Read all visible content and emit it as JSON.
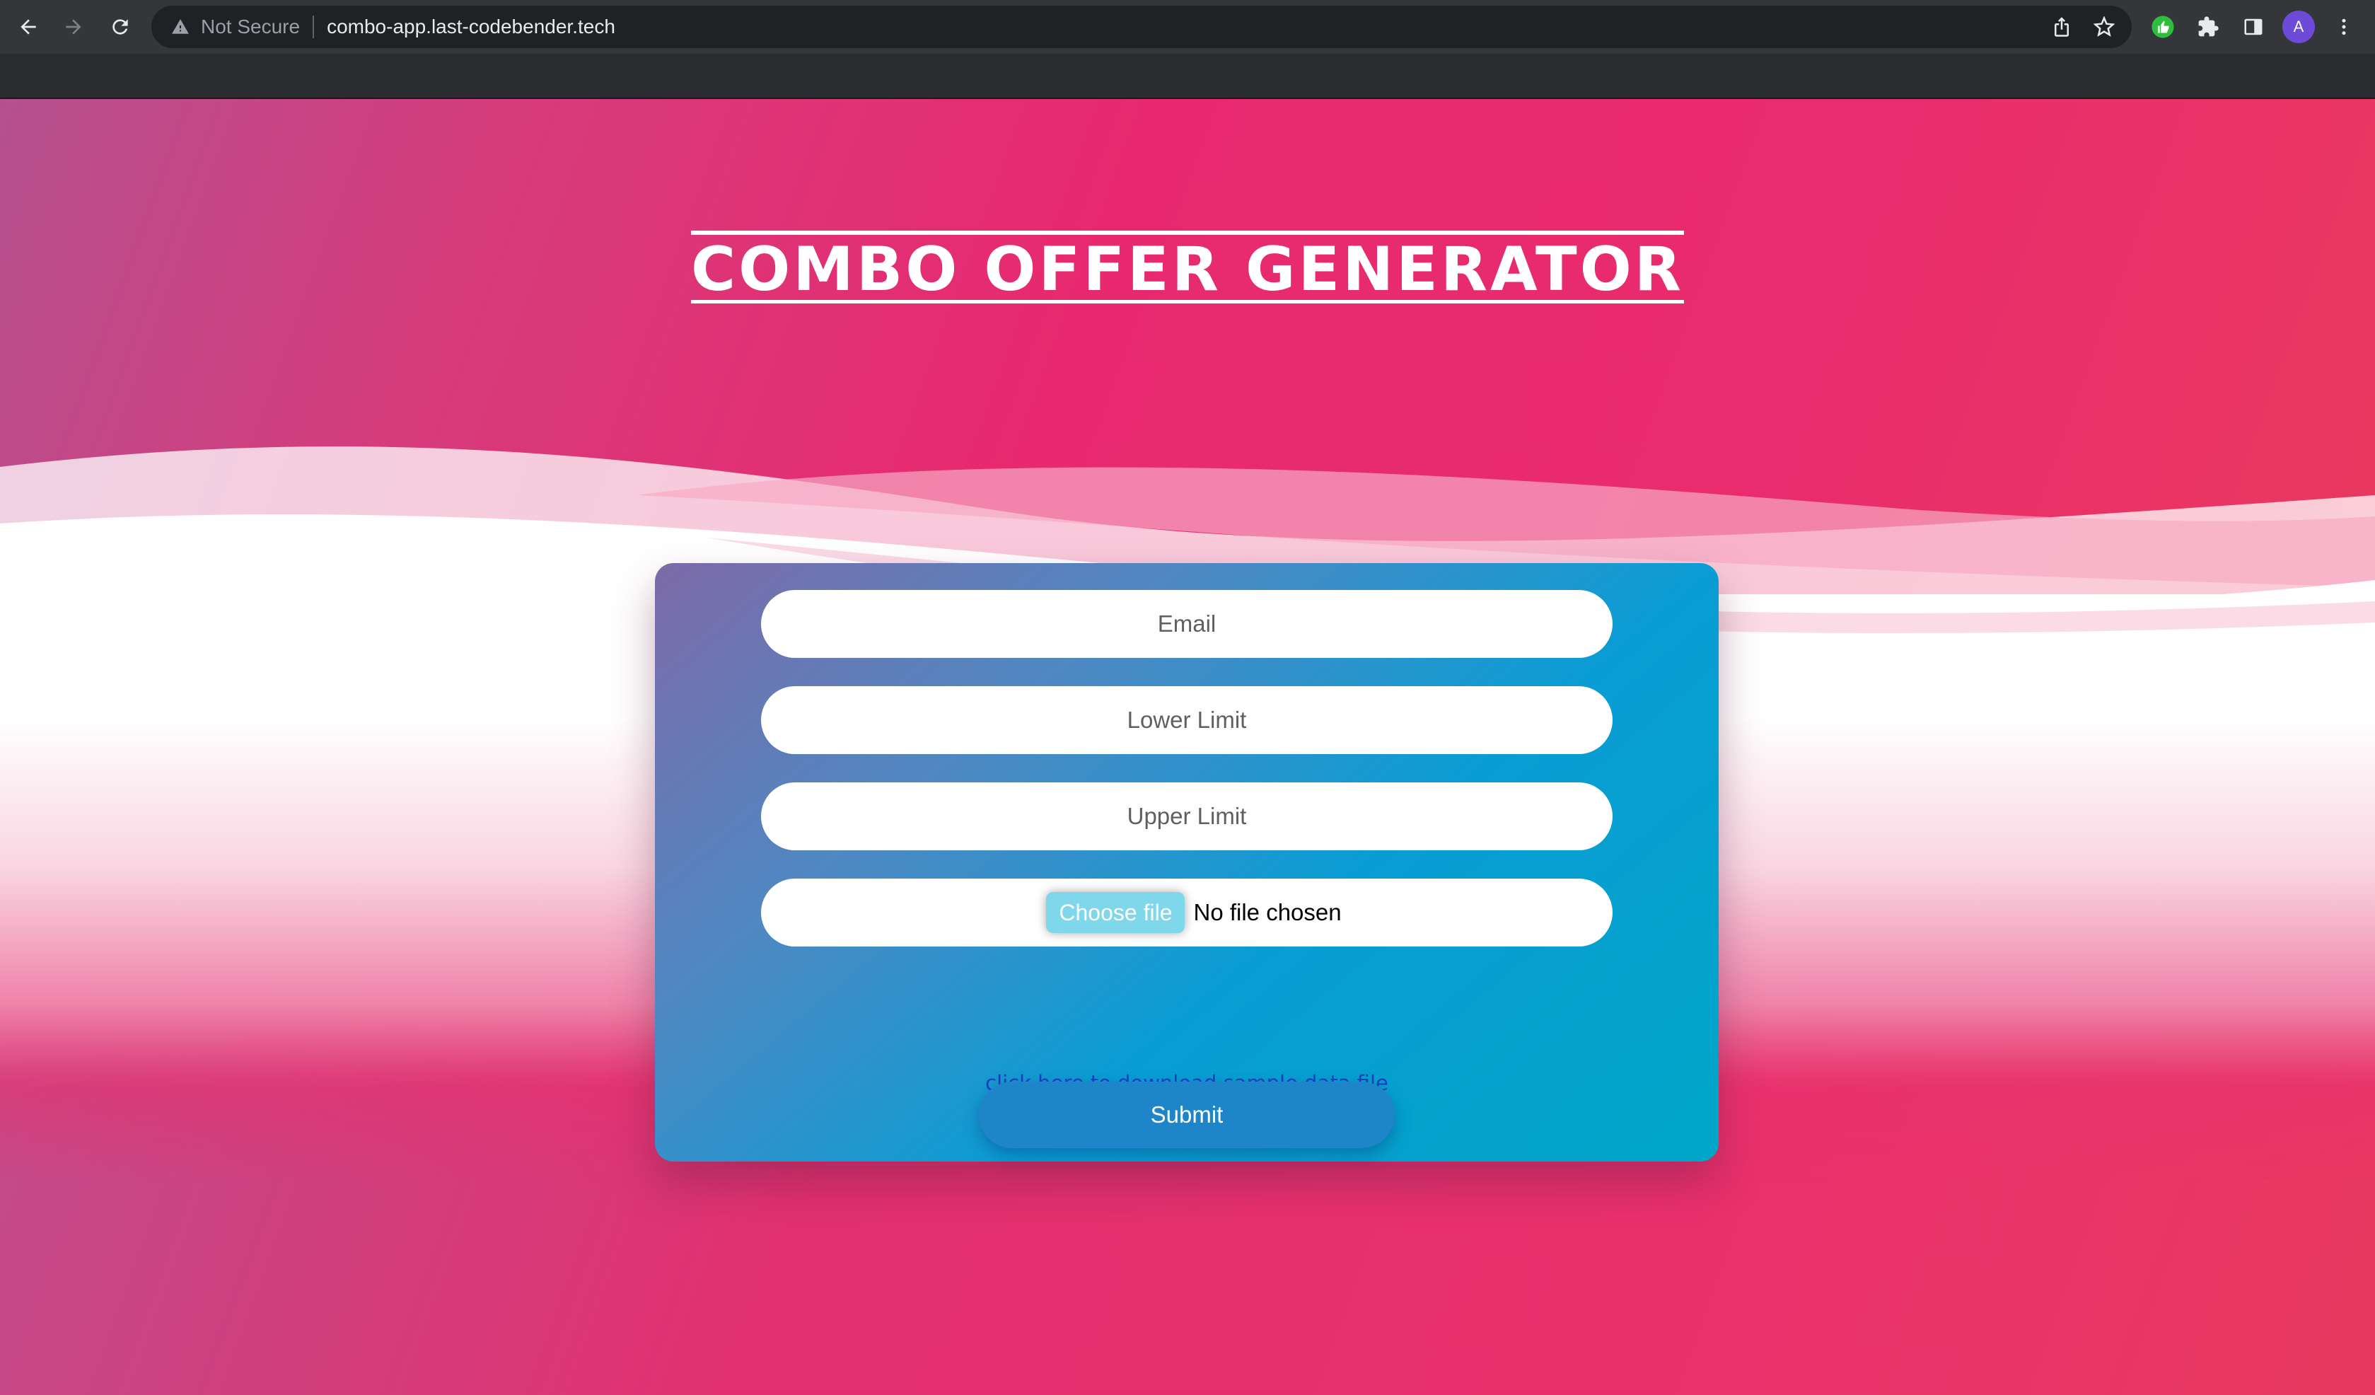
{
  "browser": {
    "security_label": "Not Secure",
    "url": "combo-app.last-codebender.tech",
    "profile_initial": "A"
  },
  "page": {
    "title": "COMBO OFFER GENERATOR"
  },
  "form": {
    "email_placeholder": "Email",
    "lower_limit_placeholder": "Lower Limit",
    "upper_limit_placeholder": "Upper Limit",
    "choose_file_label": "Choose file",
    "file_status": "No file chosen",
    "sample_link": "click here to download sample data file",
    "submit_label": "Submit"
  },
  "colors": {
    "accent_pink": "#e8296f",
    "card_blue": "#0a9dd4",
    "link_blue": "#1d3ec2"
  }
}
